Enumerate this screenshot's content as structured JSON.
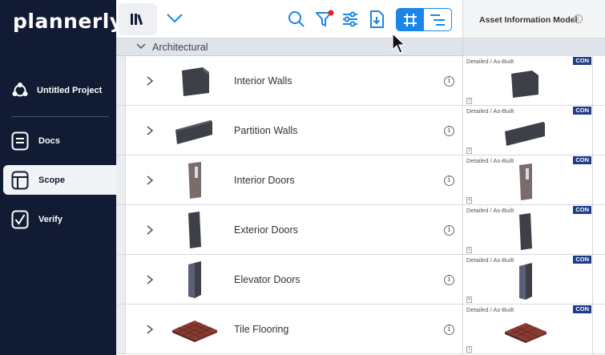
{
  "app": {
    "logo": "plannerly"
  },
  "sidebar": {
    "project_name": "Untitled Project",
    "items": [
      {
        "label": "Docs",
        "icon": "docs-icon",
        "active": false
      },
      {
        "label": "Scope",
        "icon": "scope-icon",
        "active": true
      },
      {
        "label": "Verify",
        "icon": "verify-icon",
        "active": false
      }
    ]
  },
  "toolbar": {
    "icons": [
      "library-icon",
      "chevron-down-icon",
      "search-icon",
      "filter-icon",
      "sliders-icon",
      "export-icon",
      "grid-view-icon",
      "list-view-icon"
    ],
    "accent": "#1a86e8"
  },
  "aim_header": {
    "title": "Asset Information Model"
  },
  "group": {
    "label": "Architectural"
  },
  "rows": [
    {
      "name": "Interior Walls",
      "aim_level": "Detailed / As-Built",
      "badge": "CON",
      "num": "2"
    },
    {
      "name": "Partition Walls",
      "aim_level": "Detailed / As-Built",
      "badge": "CON",
      "num": "3"
    },
    {
      "name": "Interior Doors",
      "aim_level": "Detailed / As-Built",
      "badge": "CON",
      "num": "4"
    },
    {
      "name": "Exterior Doors",
      "aim_level": "Detailed / As-Built",
      "badge": "CON",
      "num": "5"
    },
    {
      "name": "Elevator Doors",
      "aim_level": "Detailed / As-Built",
      "badge": "CON",
      "num": "6"
    },
    {
      "name": "Tile Flooring",
      "aim_level": "Detailed / As-Built",
      "badge": "CON",
      "num": "1"
    }
  ],
  "colors": {
    "sidebar": "#111b33",
    "badge": "#1f3c88",
    "filter_dot": "#e02424"
  }
}
